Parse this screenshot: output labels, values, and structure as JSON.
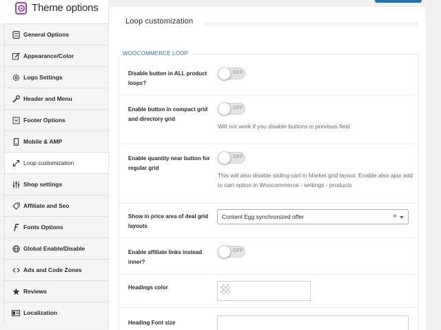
{
  "app": {
    "title": "Theme options"
  },
  "sidebar": {
    "items": [
      {
        "label": "General Options",
        "icon": "sliders-icon"
      },
      {
        "label": "Appearance/Color",
        "icon": "edit-icon"
      },
      {
        "label": "Logo Settings",
        "icon": "gear-icon"
      },
      {
        "label": "Header and Menu",
        "icon": "wrench-icon"
      },
      {
        "label": "Footer Options",
        "icon": "footer-icon"
      },
      {
        "label": "Mobile & AMP",
        "icon": "mobile-icon"
      },
      {
        "label": "Loop customization",
        "icon": "expand-icon",
        "active": true
      },
      {
        "label": "Shop settings",
        "icon": "settings-bars-icon"
      },
      {
        "label": "Affiliate and Seo",
        "icon": "tag-icon"
      },
      {
        "label": "Fonts Options",
        "icon": "font-icon"
      },
      {
        "label": "Global Enable/Disable",
        "icon": "globe-icon"
      },
      {
        "label": "Ads and Code Zones",
        "icon": "code-icon"
      },
      {
        "label": "Reviews",
        "icon": "star-icon"
      },
      {
        "label": "Localization",
        "icon": "localization-icon"
      }
    ]
  },
  "main": {
    "title": "Loop customization",
    "section_title": "WOOCOMMERCE LOOP",
    "fields": {
      "disable_button": {
        "label": "Disable button in ALL product loops?",
        "toggle": "OFF"
      },
      "enable_compact": {
        "label": "Enable button in compact grid and directory grid",
        "toggle": "OFF",
        "desc": "Will not work if you disable buttons in previous field"
      },
      "enable_quantity": {
        "label": "Enable quantity near button for regular grid",
        "toggle": "OFF",
        "desc": "This will also disable sliding cart in Market grid layout. Enable also ajax add to cart option in Woocommerce - settings - products"
      },
      "price_area": {
        "label": "Show in price area of deal grid layouts",
        "value": "Content Egg synchronized offer",
        "clear": "×"
      },
      "affiliate_links": {
        "label": "Enable affiliate links instead inner?",
        "toggle": "OFF"
      },
      "headings_color": {
        "label": "Headings color"
      },
      "heading_font_size": {
        "label": "Heading Font size"
      }
    }
  },
  "colors": {
    "accent": "#2271b1",
    "toggle_off": "#e4e4e4"
  }
}
